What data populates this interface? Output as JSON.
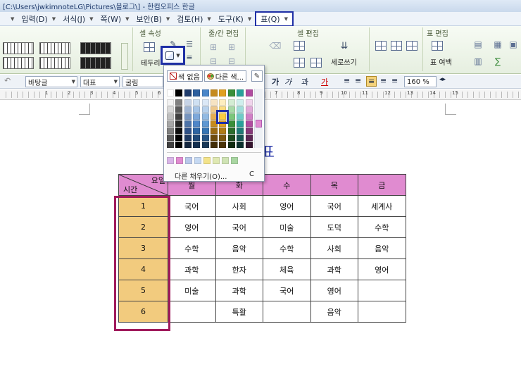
{
  "window": {
    "title": "[C:\\Users\\jwkimnoteLG\\Pictures\\블로그\\] - 한컴오피스 한글"
  },
  "menu": {
    "items": [
      {
        "label": "입력(D)",
        "key": "input"
      },
      {
        "label": "서식(J)",
        "key": "format"
      },
      {
        "label": "쪽(W)",
        "key": "page"
      },
      {
        "label": "보안(B)",
        "key": "security"
      },
      {
        "label": "검토(H)",
        "key": "review"
      },
      {
        "label": "도구(K)",
        "key": "tools"
      },
      {
        "label": "표(Q)",
        "key": "table"
      }
    ]
  },
  "ribbon": {
    "groups": {
      "cell_props": "셀 속성",
      "row_col_edit": "줄/칸 편집",
      "cell_edit": "셀 편집",
      "table_edit": "표 편집"
    },
    "border_label": "테두리",
    "vertical_text_label": "세로쓰기",
    "table_margin_label": "표 여백"
  },
  "toolbar": {
    "style_value": "바탕글",
    "lang_value": "대표",
    "font_value": "굴림",
    "zoom_value": "160",
    "zoom_unit": "%"
  },
  "ruler": {
    "marks": [
      "1",
      "2",
      "3",
      "4",
      "5",
      "6",
      "7",
      "8",
      "9",
      "10",
      "11",
      "12",
      "13",
      "14",
      "15"
    ]
  },
  "color_popup": {
    "no_color_label": "색 없음",
    "other_color_label": "다른 색...",
    "more_fill_label": "다른 채우기(O)...",
    "more_fill_key": "C",
    "highlight_color": "#1f2fa5"
  },
  "document": {
    "title": "시간표",
    "table": {
      "corner_top": "요일",
      "corner_bottom": "시간",
      "days": [
        "월",
        "화",
        "수",
        "목",
        "금"
      ],
      "rows": [
        {
          "period": "1",
          "cells": [
            "국어",
            "사회",
            "영어",
            "국어",
            "세계사"
          ]
        },
        {
          "period": "2",
          "cells": [
            "영어",
            "국어",
            "미술",
            "도덕",
            "수학"
          ]
        },
        {
          "period": "3",
          "cells": [
            "수학",
            "음악",
            "수학",
            "사회",
            "음악"
          ]
        },
        {
          "period": "4",
          "cells": [
            "과학",
            "한자",
            "체육",
            "과학",
            "영어"
          ]
        },
        {
          "period": "5",
          "cells": [
            "미술",
            "과학",
            "국어",
            "영어",
            ""
          ]
        },
        {
          "period": "6",
          "cells": [
            "",
            "특활",
            "",
            "음악",
            ""
          ]
        }
      ],
      "header_color": "#e08bd0",
      "rowhead_color": "#f2cb7e",
      "selection_color": "#a01a5c"
    }
  }
}
